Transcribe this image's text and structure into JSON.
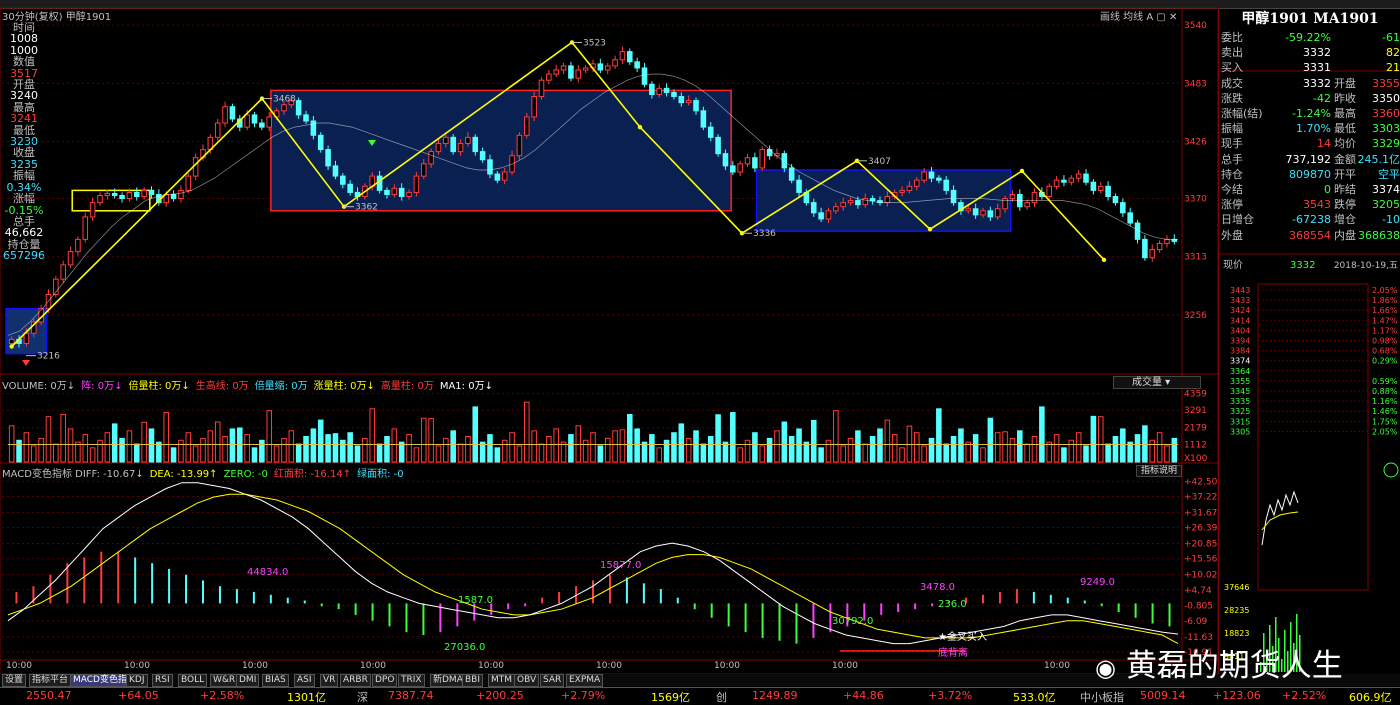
{
  "window": {
    "chart_title": "30分钟(复权)  甲醇1901",
    "tools": "画线  均线  A  ▢ ✕"
  },
  "info_panel": [
    {
      "label": "时间",
      "value": "1008",
      "cls": "ip-white"
    },
    {
      "label": "",
      "value": "1000",
      "cls": "ip-white"
    },
    {
      "label": "数值",
      "value": "3517",
      "cls": "ip-red"
    },
    {
      "label": "开盘",
      "value": "3240",
      "cls": "ip-white"
    },
    {
      "label": "最高",
      "value": "3241",
      "cls": "ip-red"
    },
    {
      "label": "最低",
      "value": "3230",
      "cls": "ip-cyan"
    },
    {
      "label": "收盘",
      "value": "3235",
      "cls": "ip-cyan"
    },
    {
      "label": "振幅",
      "value": "0.34%",
      "cls": "ip-cyan"
    },
    {
      "label": "涨幅",
      "value": "-0.15%",
      "cls": "ip-green"
    },
    {
      "label": "总手",
      "value": "46,662",
      "cls": "ip-white"
    },
    {
      "label": "持仓量",
      "value": "657296",
      "cls": "ip-cyan"
    }
  ],
  "volume_header": [
    {
      "text": "VOLUME: 0万↓",
      "color": "#c0c0c0"
    },
    {
      "text": "阵: 0万↓",
      "color": "#ff40ff"
    },
    {
      "text": "倍量柱: 0万↓",
      "color": "#ffff00"
    },
    {
      "text": "生高线: 0万",
      "color": "#ff3c3c"
    },
    {
      "text": "倍量缩: 0万",
      "color": "#40e0ff"
    },
    {
      "text": "涨量柱: 0万↓",
      "color": "#ffff00"
    },
    {
      "text": "高量柱: 0万",
      "color": "#ff3c3c"
    },
    {
      "text": "MA1: 0万↓",
      "color": "#ffffff"
    }
  ],
  "volume_button": "成交量 ▾",
  "macd_header": [
    {
      "text": "MACD变色指标  DIFF: -10.67↓",
      "color": "#c0c0c0"
    },
    {
      "text": "DEA: -13.99↑",
      "color": "#ffff00"
    },
    {
      "text": "ZERO: -0",
      "color": "#3cff3c"
    },
    {
      "text": "红面积: -16.14↑",
      "color": "#ff3c3c"
    },
    {
      "text": "绿面积: -0",
      "color": "#40e0ff"
    }
  ],
  "macd_button": "指标说明",
  "macd_labels": [
    {
      "text": "44834.0",
      "color": "#ff40ff"
    },
    {
      "text": "1587.0",
      "color": "#3cff3c"
    },
    {
      "text": "27036.0",
      "color": "#3cff3c"
    },
    {
      "text": "15877.0",
      "color": "#ff40ff"
    },
    {
      "text": "30792.0",
      "color": "#3cff3c"
    },
    {
      "text": "3478.0",
      "color": "#ff40ff"
    },
    {
      "text": "236.0",
      "color": "#3cff3c"
    },
    {
      "text": "9249.0",
      "color": "#ff40ff"
    },
    {
      "text": "★金叉买入",
      "color": "#ffffff"
    },
    {
      "text": "底背离",
      "color": "#ff40ff"
    }
  ],
  "time_labels": [
    "10:00",
    "10:00",
    "10:00",
    "10:00",
    "10:00",
    "10:00",
    "10:00",
    "10:00",
    "10:00"
  ],
  "tabs": [
    "设置",
    "指标平台",
    "MACD变色指标",
    "KDJ",
    "RSI",
    "BOLL",
    "W&R",
    "DMI",
    "BIAS",
    "ASI",
    "VR",
    "ARBR",
    "DPO",
    "TRIX",
    "新DMA",
    "BBI",
    "MTM",
    "OBV",
    "SAR",
    "EXPMA"
  ],
  "ticker": [
    {
      "text": "2550.47",
      "color": "#ff3c3c"
    },
    {
      "text": "+64.05",
      "color": "#ff3c3c"
    },
    {
      "text": "+2.58%",
      "color": "#ff3c3c"
    },
    {
      "text": "1301亿",
      "color": "#ffff00"
    },
    {
      "text": "深",
      "color": "#c0c0c0"
    },
    {
      "text": "7387.74",
      "color": "#ff3c3c"
    },
    {
      "text": "+200.25",
      "color": "#ff3c3c"
    },
    {
      "text": "+2.79%",
      "color": "#ff3c3c"
    },
    {
      "text": "1569亿",
      "color": "#ffff00"
    },
    {
      "text": "创",
      "color": "#c0c0c0"
    },
    {
      "text": "1249.89",
      "color": "#ff3c3c"
    },
    {
      "text": "+44.86",
      "color": "#ff3c3c"
    },
    {
      "text": "+3.72%",
      "color": "#ff3c3c"
    },
    {
      "text": "533.0亿",
      "color": "#ffff00"
    },
    {
      "text": "中小板指",
      "color": "#c0c0c0"
    },
    {
      "text": "5009.14",
      "color": "#ff3c3c"
    },
    {
      "text": "+123.06",
      "color": "#ff3c3c"
    },
    {
      "text": "+2.52%",
      "color": "#ff3c3c"
    },
    {
      "text": "606.9亿",
      "color": "#ffff00"
    }
  ],
  "watermark": "黄磊的期货人生",
  "quote": {
    "title": "甲醇1901 MA1901",
    "rows": [
      {
        "l": "委比",
        "v1": "-59.22%",
        "c1": "green",
        "v2": "-61",
        "c2": "green"
      },
      {
        "l": "卖出",
        "v1": "3332",
        "c1": "white",
        "v2": "82",
        "c2": "yellow"
      },
      {
        "l": "买入",
        "v1": "3331",
        "c1": "white",
        "v2": "21",
        "c2": "yellow"
      },
      {
        "l": "成交",
        "v1": "3332",
        "c1": "white",
        "l2": "开盘",
        "v2": "3355",
        "c2": "red"
      },
      {
        "l": "涨跌",
        "v1": "-42",
        "c1": "green",
        "l2": "昨收",
        "v2": "3350",
        "c2": "white"
      },
      {
        "l": "涨幅(结)",
        "v1": "-1.24%",
        "c1": "green",
        "l2": "最高",
        "v2": "3360",
        "c2": "red"
      },
      {
        "l": "振幅",
        "v1": "1.70%",
        "c1": "cyan",
        "l2": "最低",
        "v2": "3303",
        "c2": "green"
      },
      {
        "l": "现手",
        "v1": "14",
        "c1": "red",
        "l2": "均价",
        "v2": "3329",
        "c2": "green"
      },
      {
        "l": "总手",
        "v1": "737,192",
        "c1": "white",
        "l2": "金额",
        "v2": "245.1亿",
        "c2": "cyan"
      },
      {
        "l": "持仓",
        "v1": "809870",
        "c1": "cyan",
        "l2": "开平",
        "v2": "空平",
        "c2": "cyan"
      },
      {
        "l": "今结",
        "v1": "0",
        "c1": "green",
        "l2": "昨结",
        "v2": "3374",
        "c2": "white"
      },
      {
        "l": "涨停",
        "v1": "3543",
        "c1": "red",
        "l2": "跌停",
        "v2": "3205",
        "c2": "green"
      },
      {
        "l": "日增仓",
        "v1": "-67238",
        "c1": "cyan",
        "l2": "增仓",
        "v2": "-10",
        "c2": "cyan"
      },
      {
        "l": "外盘",
        "v1": "368554",
        "c1": "red",
        "l2": "内盘",
        "v2": "368638",
        "c2": "green"
      }
    ],
    "price_label": "现价",
    "price": "3332",
    "date": "2018-10-19,五",
    "mini_prices": [
      "3443",
      "3433",
      "3424",
      "3414",
      "3404",
      "3394",
      "3384",
      "3374",
      "3364",
      "3355",
      "3345",
      "3335",
      "3325",
      "3315",
      "3305"
    ],
    "mini_pcts": [
      "2.05%",
      "1.86%",
      "1.66%",
      "1.47%",
      "1.17%",
      "0.98%",
      "0.68%",
      "0.29%",
      "",
      "0.59%",
      "0.88%",
      "1.16%",
      "1.46%",
      "1.75%",
      "2.05%"
    ],
    "mini_vol": [
      "37646",
      "28235",
      "18823",
      "9411"
    ]
  },
  "chart_data": [
    {
      "type": "candlestick",
      "title": "30分钟(复权) 甲醇1901",
      "y_axis_ticks": [
        3540,
        3483,
        3426,
        3370,
        3313,
        3256
      ],
      "ylim": [
        3200,
        3545
      ],
      "annotations": [
        {
          "label": "3216",
          "value": 3216
        },
        {
          "label": "3468",
          "value": 3468
        },
        {
          "label": "3362",
          "value": 3362
        },
        {
          "label": "3523",
          "value": 3523
        },
        {
          "label": "3336",
          "value": 3336
        },
        {
          "label": "3407",
          "value": 3407
        }
      ],
      "zigzag_values": [
        3225,
        3468,
        3362,
        3523,
        3440,
        3336,
        3407,
        3340,
        3397,
        3310
      ],
      "boxes": [
        {
          "from": 3262,
          "to": 3218,
          "fill": "#103070"
        },
        {
          "from": 3378,
          "to": 3358,
          "fill": "none"
        },
        {
          "from": 3476,
          "to": 3358,
          "fill": "#0a2050"
        },
        {
          "from": 3398,
          "to": 3338,
          "fill": "#0a2050"
        }
      ],
      "closes": [
        3232,
        3228,
        3238,
        3249,
        3262,
        3276,
        3291,
        3305,
        3318,
        3330,
        3352,
        3366,
        3373,
        3375,
        3373,
        3370,
        3376,
        3372,
        3378,
        3374,
        3366,
        3374,
        3370,
        3378,
        3392,
        3410,
        3418,
        3430,
        3444,
        3460,
        3448,
        3440,
        3452,
        3444,
        3440,
        3450,
        3456,
        3462,
        3466,
        3452,
        3446,
        3432,
        3418,
        3402,
        3392,
        3384,
        3376,
        3372,
        3382,
        3392,
        3378,
        3374,
        3380,
        3372,
        3376,
        3392,
        3404,
        3416,
        3424,
        3430,
        3416,
        3424,
        3430,
        3416,
        3408,
        3394,
        3388,
        3396,
        3412,
        3432,
        3450,
        3470,
        3486,
        3492,
        3496,
        3500,
        3488,
        3496,
        3498,
        3502,
        3496,
        3500,
        3506,
        3514,
        3504,
        3498,
        3482,
        3472,
        3478,
        3474,
        3470,
        3464,
        3466,
        3456,
        3440,
        3430,
        3414,
        3402,
        3396,
        3404,
        3410,
        3400,
        3418,
        3412,
        3414,
        3400,
        3388,
        3376,
        3366,
        3356,
        3350,
        3358,
        3362,
        3366,
        3368,
        3364,
        3370,
        3368,
        3366,
        3372,
        3376,
        3378,
        3382,
        3388,
        3396,
        3390,
        3388,
        3378,
        3366,
        3358,
        3360,
        3354,
        3358,
        3352,
        3360,
        3370,
        3374,
        3362,
        3366,
        3376,
        3372,
        3382,
        3388,
        3386,
        3390,
        3394,
        3386,
        3378,
        3382,
        3372,
        3366,
        3356,
        3346,
        3330,
        3312,
        3320,
        3326,
        3330,
        3328
      ],
      "ma_values": [
        3236,
        3240,
        3250,
        3262,
        3276,
        3290,
        3304,
        3318,
        3330,
        3342,
        3352,
        3360,
        3368,
        3372,
        3374,
        3375,
        3378,
        3384,
        3390,
        3398,
        3406,
        3414,
        3422,
        3430,
        3436,
        3440,
        3442,
        3444,
        3444,
        3442,
        3440,
        3436,
        3432,
        3428,
        3424,
        3420,
        3416,
        3412,
        3408,
        3404,
        3400,
        3398,
        3398,
        3400,
        3404,
        3410,
        3418,
        3428,
        3438,
        3448,
        3458,
        3466,
        3474,
        3480,
        3486,
        3490,
        3492,
        3492,
        3490,
        3486,
        3480,
        3472,
        3462,
        3452,
        3442,
        3432,
        3422,
        3412,
        3404,
        3396,
        3390,
        3384,
        3378,
        3374,
        3370,
        3368,
        3366,
        3366,
        3366,
        3367,
        3368,
        3369,
        3370,
        3370,
        3370,
        3370,
        3369,
        3368,
        3368,
        3368,
        3368,
        3368,
        3368,
        3366,
        3364,
        3360,
        3354,
        3348,
        3342,
        3336,
        3332,
        3330,
        3330
      ]
    },
    {
      "type": "bar",
      "title": "VOLUME",
      "y_axis_ticks": [
        4359,
        3291,
        2179,
        1112
      ],
      "ylim": [
        0,
        4700
      ],
      "unit": "X100",
      "ma_value": 1112
    },
    {
      "type": "bar",
      "title": "MACD变色指标",
      "y_axis_ticks": [
        42.5,
        37.22,
        31.67,
        26.39,
        20.85,
        15.56,
        10.02,
        4.74,
        -0.805,
        -6.09,
        -11.63,
        -16.91
      ],
      "y_tick_labels": [
        "+42.50",
        "+37.22",
        "+31.67",
        "+26.39",
        "+20.85",
        "+15.56",
        "+10.02",
        "+4.74",
        "-0.805",
        "-6.09",
        "-11.63",
        "-16.91"
      ],
      "ylim": [
        -19,
        44
      ],
      "diff": [
        -6,
        -2,
        3,
        8,
        14,
        20,
        26,
        30,
        34,
        37,
        40,
        42,
        42,
        41,
        40,
        38,
        36,
        33,
        30,
        26,
        21,
        16,
        11,
        7,
        4,
        2,
        0,
        -1,
        -2,
        -3,
        -4,
        -5,
        -5,
        -4,
        -2,
        0,
        3,
        6,
        10,
        14,
        18,
        20,
        21,
        20,
        18,
        15,
        11,
        7,
        3,
        -1,
        -4,
        -7,
        -9,
        -11,
        -12,
        -13,
        -14,
        -14,
        -13,
        -12,
        -11,
        -10,
        -9,
        -8,
        -6,
        -5,
        -4,
        -4,
        -5,
        -6,
        -7,
        -8,
        -9,
        -10,
        -10.67
      ],
      "dea": [
        -4,
        -2,
        0,
        3,
        6,
        10,
        14,
        18,
        22,
        26,
        29,
        32,
        35,
        37,
        38,
        38,
        37,
        36,
        34,
        32,
        29,
        26,
        22,
        18,
        14,
        10,
        7,
        4,
        2,
        0,
        -2,
        -3,
        -4,
        -4,
        -3,
        -2,
        0,
        2,
        5,
        8,
        11,
        14,
        16,
        17,
        17,
        16,
        14,
        12,
        9,
        6,
        3,
        0,
        -3,
        -5,
        -7,
        -9,
        -10,
        -11,
        -12,
        -12,
        -12,
        -12,
        -11,
        -10,
        -9,
        -8,
        -7,
        -6,
        -6,
        -7,
        -8,
        -9,
        -10,
        -11,
        -13.99
      ],
      "hist": [
        4,
        6,
        10,
        14,
        16,
        18,
        18,
        16,
        14,
        12,
        10,
        8,
        6,
        5,
        4,
        3,
        2,
        1,
        -1,
        -2,
        -4,
        -6,
        -8,
        -10,
        -11,
        -10,
        -8,
        -6,
        -4,
        -2,
        -1,
        2,
        4,
        6,
        8,
        10,
        9,
        7,
        5,
        2,
        -2,
        -5,
        -8,
        -10,
        -12,
        -13,
        -14,
        -12,
        -10,
        -8,
        -6,
        -4,
        -3,
        -2,
        -1,
        1,
        2,
        3,
        4,
        5,
        4,
        3,
        2,
        1,
        -1,
        -3,
        -5,
        -7,
        -8
      ]
    }
  ]
}
